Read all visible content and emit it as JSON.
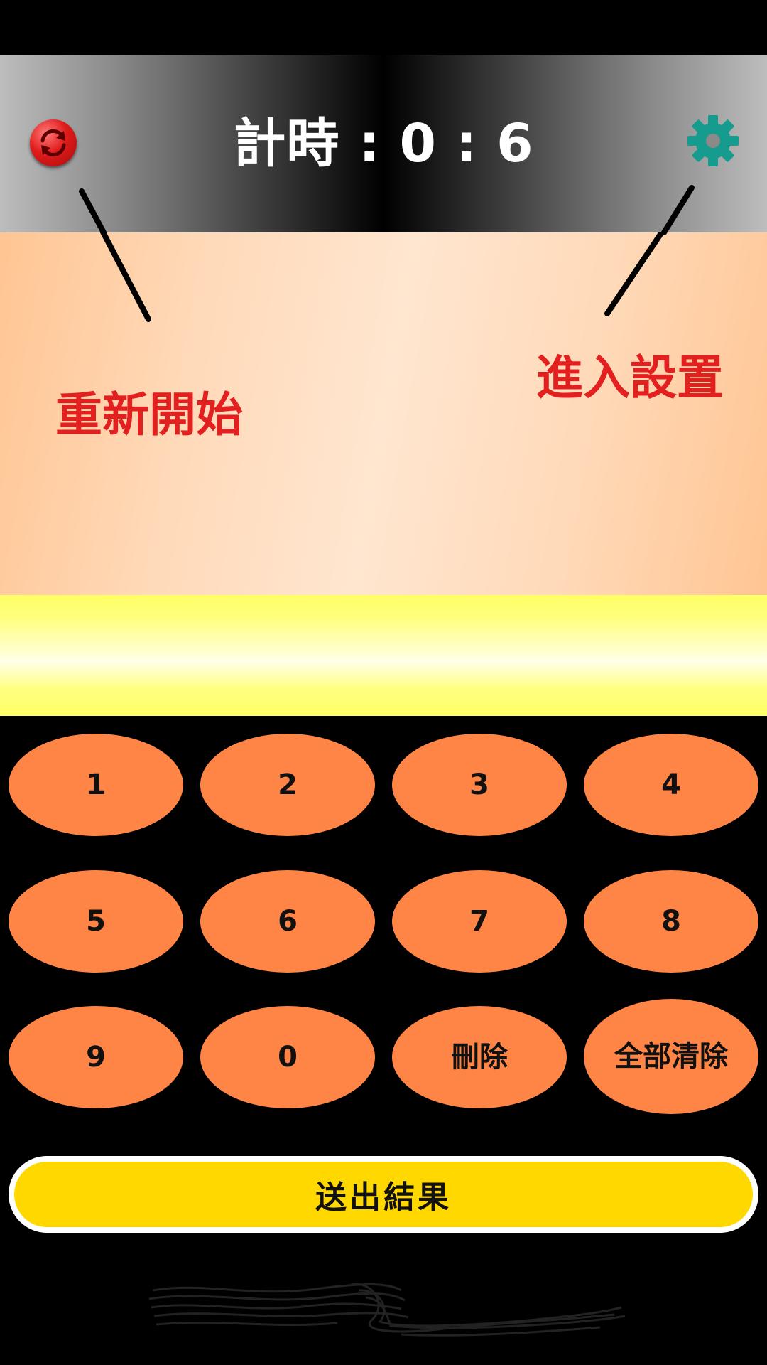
{
  "header": {
    "timer": "計時 : 0 : 6"
  },
  "hints": {
    "restart": "重新開始",
    "settings": "進入設置"
  },
  "keypad": {
    "keys": [
      "1",
      "2",
      "3",
      "4",
      "5",
      "6",
      "7",
      "8",
      "9",
      "0",
      "刪除",
      "全部清除"
    ]
  },
  "submit_label": "送出結果",
  "icons": {
    "restart": "refresh-icon",
    "settings": "gear-icon"
  },
  "colors": {
    "hint_text": "#e32020",
    "key_fill": "#ff8547",
    "submit_fill": "#ffd800",
    "settings_icon": "#169b8f",
    "restart_icon": "#e01b1b"
  }
}
